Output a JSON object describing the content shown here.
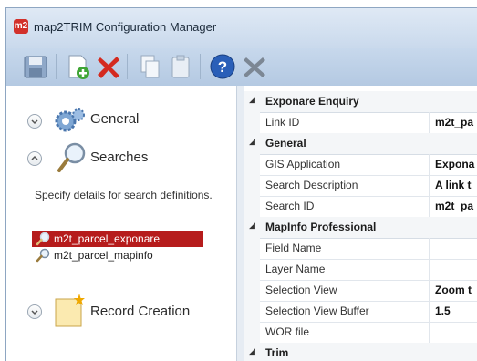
{
  "window": {
    "title": "map2TRIM Configuration Manager",
    "app_icon_text": "m2"
  },
  "toolbar": {
    "buttons": [
      {
        "icon": "save-icon"
      },
      {
        "icon": "add-document-icon"
      },
      {
        "icon": "delete-icon"
      },
      {
        "icon": "copy-icon"
      },
      {
        "icon": "paste-icon"
      },
      {
        "icon": "help-icon"
      },
      {
        "icon": "close-icon"
      }
    ]
  },
  "sidebar": {
    "sections": [
      {
        "label": "General",
        "icon": "gears-icon",
        "expanded": false
      },
      {
        "label": "Searches",
        "icon": "magnifier-icon",
        "expanded": true
      },
      {
        "label": "Record Creation",
        "icon": "new-document-icon",
        "expanded": false
      }
    ],
    "description": "Specify details for search definitions.",
    "items": [
      {
        "label": "m2t_parcel_exponare",
        "selected": true
      },
      {
        "label": "m2t_parcel_mapinfo",
        "selected": false
      }
    ]
  },
  "properties": {
    "rows": [
      {
        "type": "category",
        "name": "Exponare Enquiry"
      },
      {
        "type": "prop",
        "name": "Link ID",
        "value": "m2t_pa"
      },
      {
        "type": "category",
        "name": "General"
      },
      {
        "type": "prop",
        "name": "GIS Application",
        "value": "Expona"
      },
      {
        "type": "prop",
        "name": "Search Description",
        "value": "A link t"
      },
      {
        "type": "prop",
        "name": "Search ID",
        "value": "m2t_pa"
      },
      {
        "type": "category",
        "name": "MapInfo Professional"
      },
      {
        "type": "prop",
        "name": "Field Name",
        "value": ""
      },
      {
        "type": "prop",
        "name": "Layer Name",
        "value": ""
      },
      {
        "type": "prop",
        "name": "Selection View",
        "value": "Zoom t"
      },
      {
        "type": "prop",
        "name": "Selection View Buffer",
        "value": "1.5"
      },
      {
        "type": "prop",
        "name": "WOR file",
        "value": ""
      },
      {
        "type": "category",
        "name": "Trim"
      }
    ]
  },
  "colors": {
    "selection": "#b61c1c",
    "toolbar": "#c7d8ec"
  }
}
